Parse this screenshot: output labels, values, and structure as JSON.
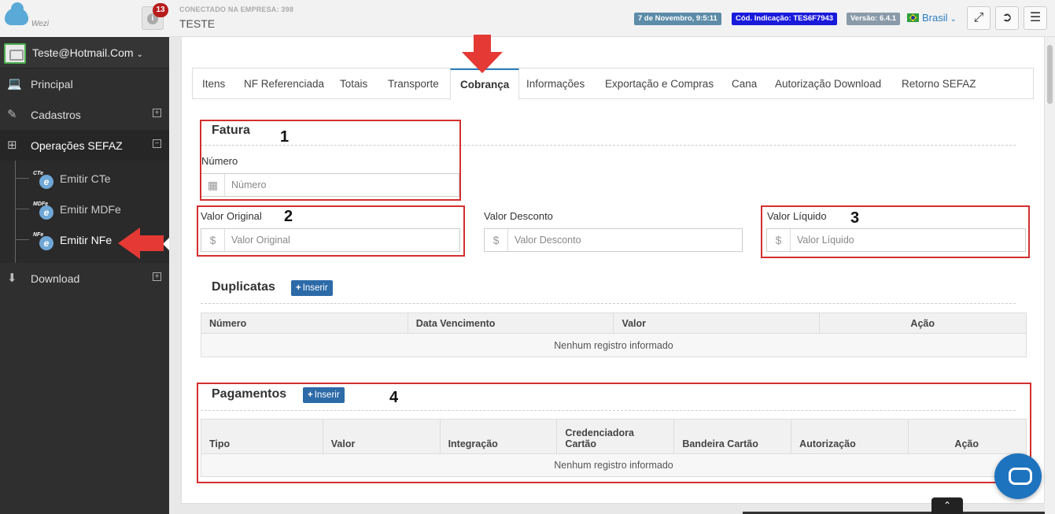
{
  "header": {
    "logo_text": "Wezi",
    "notifications": "13",
    "company_label": "CONECTADO NA EMPRESA: 398",
    "company_name": "TESTE",
    "date": "7 de Novembro, 9:5:11",
    "referral_code": "Cód. Indicação: TES6F7943",
    "version": "Versão: 6.4.1",
    "language": "Brasil"
  },
  "sidebar": {
    "user": "Teste@Hotmail.Com",
    "items": [
      {
        "label": "Principal",
        "icon": "laptop-icon"
      },
      {
        "label": "Cadastros",
        "icon": "edit-icon"
      },
      {
        "label": "Operações SEFAZ",
        "icon": "windows-icon"
      },
      {
        "label": "Download",
        "icon": "download-icon"
      }
    ],
    "sub_items": [
      {
        "tag": "CTe",
        "label": "Emitir CTe"
      },
      {
        "tag": "MDFe",
        "label": "Emitir MDFe"
      },
      {
        "tag": "NFe",
        "label": "Emitir NFe"
      }
    ]
  },
  "tabs": [
    "Itens",
    "NF Referenciada",
    "Totais",
    "Transporte",
    "Cobrança",
    "Informações",
    "Exportação e Compras",
    "Cana",
    "Autorização Download",
    "Retorno SEFAZ"
  ],
  "active_tab": "Cobrança",
  "fatura": {
    "title": "Fatura",
    "numero_label": "Número",
    "numero_placeholder": "Número",
    "valor_original_label": "Valor Original",
    "valor_original_placeholder": "Valor Original",
    "valor_desconto_label": "Valor Desconto",
    "valor_desconto_placeholder": "Valor Desconto",
    "valor_liquido_label": "Valor Líquido",
    "valor_liquido_placeholder": "Valor Líquido"
  },
  "duplicatas": {
    "title": "Duplicatas",
    "insert_label": "Inserir",
    "columns": [
      "Número",
      "Data Vencimento",
      "Valor",
      "Ação"
    ],
    "empty": "Nenhum registro informado"
  },
  "pagamentos": {
    "title": "Pagamentos",
    "insert_label": "Inserir",
    "columns": [
      "Tipo",
      "Valor",
      "Integração",
      "Credenciadora Cartão",
      "Bandeira Cartão",
      "Autorização",
      "Ação"
    ],
    "empty": "Nenhum registro informado"
  },
  "annotations": [
    "1",
    "2",
    "3",
    "4"
  ],
  "colors": {
    "accent": "#2b7ec1",
    "annotation_red": "#d32f2f",
    "sidebar": "#2f2f2f"
  }
}
